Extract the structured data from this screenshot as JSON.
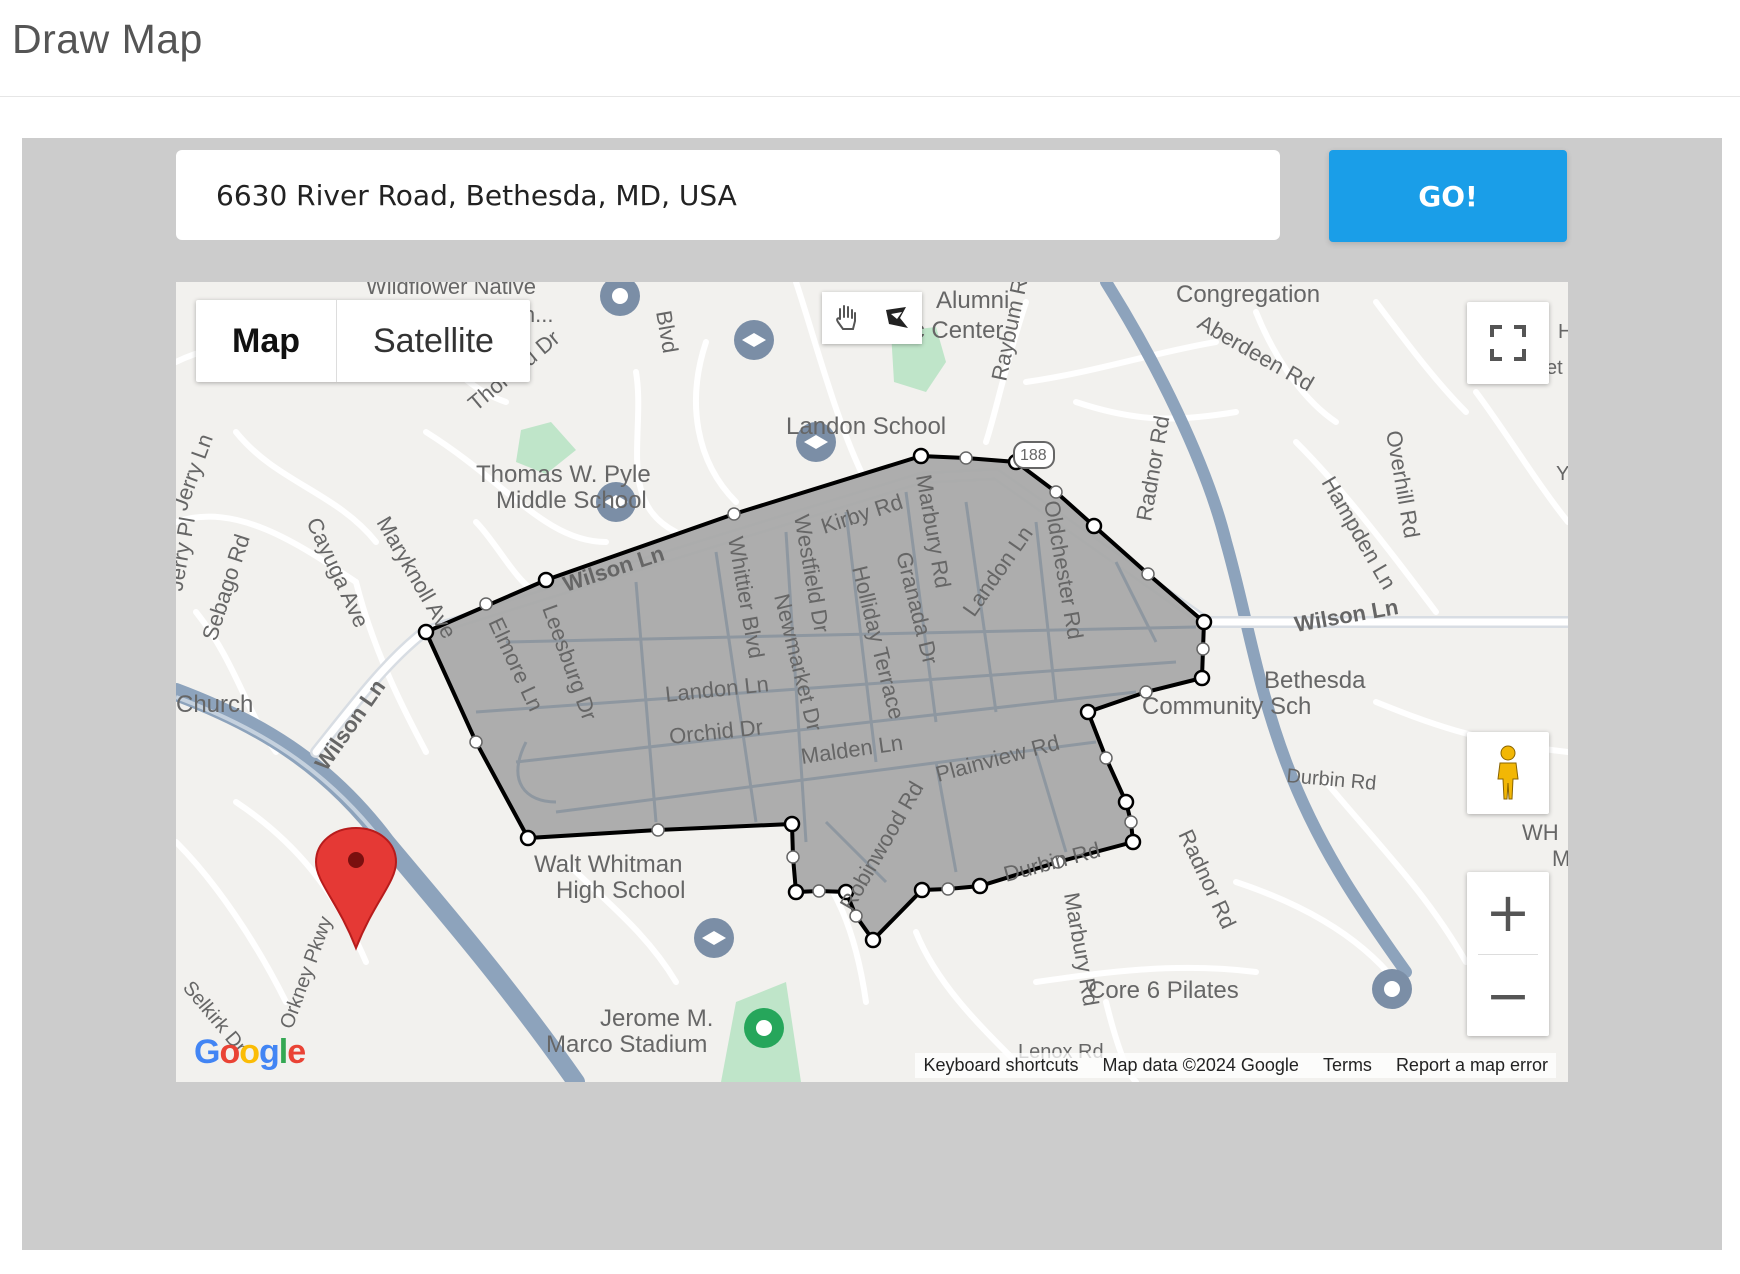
{
  "page": {
    "title": "Draw Map"
  },
  "search": {
    "value": "6630 River Road, Bethesda, MD, USA",
    "button": "GO!"
  },
  "map": {
    "type_control": {
      "map": "Map",
      "satellite": "Satellite"
    },
    "streets": {
      "wildflower": "Wildflower Native",
      "pen": "Pen...",
      "blvd": "Blvd",
      "thoreau": "Thoreau Dr",
      "alumni_1": "Alumni",
      "alumni_2": "Athletic Center",
      "raybum": "Raybum Rd",
      "congregation": "Congregation",
      "aberdeen": "Aberdeen Rd",
      "lampet": "Lampet",
      "hu": "Hu",
      "landon_school": "Landon School",
      "route": "188",
      "pyle_1": "Thomas W. Pyle",
      "pyle_2": "Middle School",
      "jerry_ln": "Jerry Ln",
      "jerry_pl": "Jerry Pl",
      "cayuga": "Cayuga Ave",
      "sebago": "Sebago Rd",
      "maryknoll": "Maryknoll Ave",
      "wilson_top": "Wilson Ln",
      "whittier": "Whittier Blvd",
      "westfield": "Westfield Dr",
      "kirby": "Kirby Rd",
      "marbury_top": "Marbury Rd",
      "oldchester": "Oldchester Rd",
      "radnor_top": "Radnor Rd",
      "overhill": "Overhill Rd",
      "hampden": "Hampden Ln",
      "y": "Y",
      "holliday": "Holliday Terrace",
      "granada": "Granada Dr",
      "landon_ln_diag": "Landon Ln",
      "wilson_right": "Wilson Ln",
      "elmore": "Elmore Ln",
      "leesburg": "Leesburg Dr",
      "newmarket": "Newmarket Dr",
      "bethesda_1": "Bethesda",
      "bethesda_2": "Community Sch",
      "church": "Church",
      "landon_ln": "Landon Ln",
      "orchid": "Orchid Dr",
      "malden": "Malden Ln",
      "plainview": "Plainview Rd",
      "durbin_right": "Durbin Rd",
      "wilson_left": "Wilson Ln",
      "whitman_1": "Walt Whitman",
      "whitman_2": "High School",
      "robinwood": "Robinwood Rd",
      "durbin_bottom": "Durbin Rd",
      "marbury_bottom": "Marbury Rd",
      "radnor_bottom": "Radnor Rd",
      "core6": "Core 6 Pilates",
      "wh": "WH",
      "m": "M",
      "orkney": "Orkney Pkwy",
      "selkirk": "Selkirk Dr",
      "jerome_1": "Jerome M.",
      "jerome_2": "Marco Stadium",
      "lenox": "Lenox Rd"
    },
    "attribution": {
      "keyboard": "Keyboard shortcuts",
      "data": "Map data ©2024 Google",
      "terms": "Terms",
      "report": "Report a map error"
    },
    "logo": "Google",
    "icons": {
      "hand": "hand-icon",
      "polygon": "polygon-draw-icon",
      "fullscreen": "fullscreen-icon",
      "pegman": "pegman-icon",
      "zoom_in": "zoom-in-icon",
      "zoom_out": "zoom-out-icon",
      "marker": "map-marker-icon"
    },
    "colors": {
      "polygon_fill": "#a9a9a9",
      "go_button": "#1a9ee8",
      "road": "#ffffff",
      "highway": "#8da3bc"
    }
  }
}
